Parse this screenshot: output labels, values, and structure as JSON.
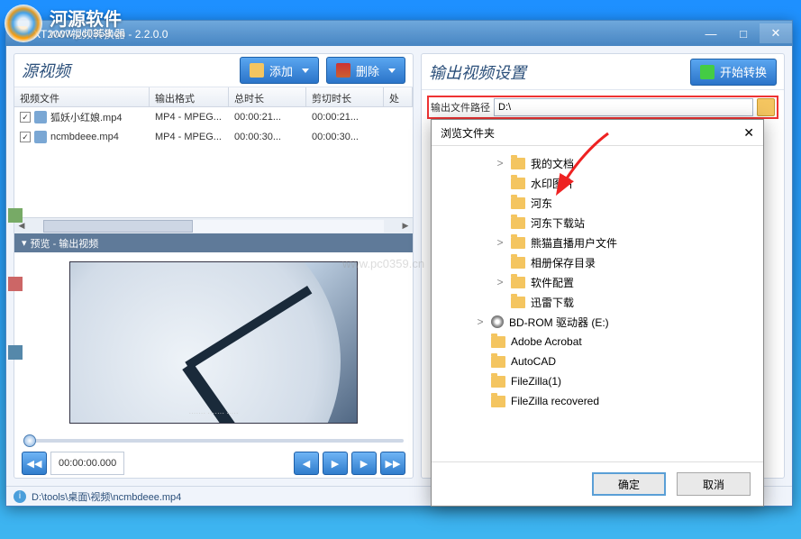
{
  "watermark": {
    "site_name": "河源软件",
    "url": "www.pc0359.cn",
    "center": "www.pc0359.cn"
  },
  "titlebar": {
    "title": "XT2007视频转换器 - 2.2.0.0"
  },
  "left_panel": {
    "title": "源视频",
    "add_label": "添加",
    "del_label": "删除",
    "columns": [
      "视频文件",
      "输出格式",
      "总时长",
      "剪切时长",
      "处"
    ],
    "rows": [
      {
        "checked": true,
        "name": "狐妖小红娘.mp4",
        "fmt": "MP4 - MPEG...",
        "dur": "00:00:21...",
        "cut": "00:00:21..."
      },
      {
        "checked": true,
        "name": "ncmbdeee.mp4",
        "fmt": "MP4 - MPEG...",
        "dur": "00:00:30...",
        "cut": "00:00:30..."
      }
    ],
    "preview_title": "预览 - 输出视频",
    "subtitle": "······· ······· ·····",
    "timecode": "00:00:00.000"
  },
  "right_panel": {
    "title": "输出视频设置",
    "start_label": "开始转换",
    "path_label": "输出文件路径",
    "path_value": "D:\\"
  },
  "dialog": {
    "title": "浏览文件夹",
    "ok": "确定",
    "cancel": "取消",
    "tree": [
      {
        "level": 2,
        "exp": ">",
        "icon": "folder",
        "label": "我的文档"
      },
      {
        "level": 2,
        "exp": "",
        "icon": "folder",
        "label": "水印图片"
      },
      {
        "level": 2,
        "exp": "",
        "icon": "folder",
        "label": "河东"
      },
      {
        "level": 2,
        "exp": "",
        "icon": "folder",
        "label": "河东下载站"
      },
      {
        "level": 2,
        "exp": ">",
        "icon": "folder",
        "label": "熊猫直播用户文件"
      },
      {
        "level": 2,
        "exp": "",
        "icon": "folder",
        "label": "相册保存目录"
      },
      {
        "level": 2,
        "exp": ">",
        "icon": "folder",
        "label": "软件配置"
      },
      {
        "level": 2,
        "exp": "",
        "icon": "folder",
        "label": "迅雷下载"
      },
      {
        "level": 1,
        "exp": ">",
        "icon": "disc",
        "label": "BD-ROM 驱动器 (E:)"
      },
      {
        "level": 1,
        "exp": "",
        "icon": "folder",
        "label": "Adobe Acrobat"
      },
      {
        "level": 1,
        "exp": "",
        "icon": "folder",
        "label": "AutoCAD"
      },
      {
        "level": 1,
        "exp": "",
        "icon": "folder",
        "label": "FileZilla(1)"
      },
      {
        "level": 1,
        "exp": "",
        "icon": "folder",
        "label": "FileZilla recovered"
      }
    ]
  },
  "statusbar": {
    "path": "D:\\tools\\桌面\\视频\\ncmbdeee.mp4"
  }
}
